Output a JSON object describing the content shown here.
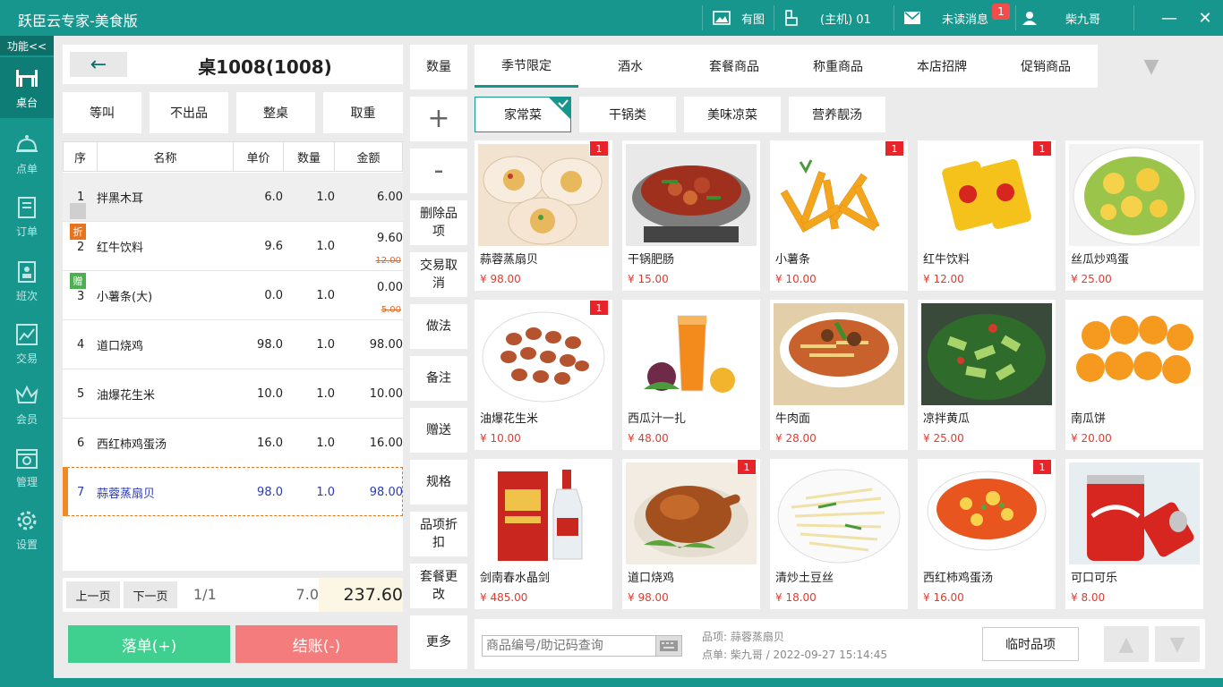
{
  "app": {
    "title": "跃臣云专家-美食版"
  },
  "titlebar": {
    "image_toggle": "有图",
    "host": "(主机) 01",
    "messages": "未读消息",
    "message_count": "1",
    "user": "柴九哥",
    "minimize": "—",
    "close": "✕"
  },
  "sidebar": {
    "func_label": "功能<<",
    "items": [
      {
        "label": "桌台",
        "icon": "table-icon"
      },
      {
        "label": "点单",
        "icon": "bell-icon"
      },
      {
        "label": "订单",
        "icon": "order-icon"
      },
      {
        "label": "班次",
        "icon": "shift-icon"
      },
      {
        "label": "交易",
        "icon": "chart-icon"
      },
      {
        "label": "会员",
        "icon": "crown-icon"
      },
      {
        "label": "管理",
        "icon": "calendar-gear-icon"
      },
      {
        "label": "设置",
        "icon": "gear-icon"
      }
    ]
  },
  "order": {
    "back": "←",
    "table_title": "桌1008(1008)",
    "actions": [
      "等叫",
      "不出品",
      "整桌",
      "取重"
    ],
    "headers": [
      "序",
      "名称",
      "单价",
      "数量",
      "金额"
    ],
    "rows": [
      {
        "no": "1",
        "name": "拌黑木耳",
        "price": "6.0",
        "qty": "1.0",
        "amount": "6.00",
        "tag": "",
        "orig": ""
      },
      {
        "no": "2",
        "name": "红牛饮料",
        "price": "9.6",
        "qty": "1.0",
        "amount": "9.60",
        "tag": "折",
        "orig": "12.00"
      },
      {
        "no": "3",
        "name": "小薯条(大)",
        "price": "0.0",
        "qty": "1.0",
        "amount": "0.00",
        "tag": "赠",
        "orig": "5.00"
      },
      {
        "no": "4",
        "name": "道口烧鸡",
        "price": "98.0",
        "qty": "1.0",
        "amount": "98.00",
        "tag": "",
        "orig": ""
      },
      {
        "no": "5",
        "name": "油爆花生米",
        "price": "10.0",
        "qty": "1.0",
        "amount": "10.00",
        "tag": "",
        "orig": ""
      },
      {
        "no": "6",
        "name": "西红柿鸡蛋汤",
        "price": "16.0",
        "qty": "1.0",
        "amount": "16.00",
        "tag": "",
        "orig": ""
      },
      {
        "no": "7",
        "name": "蒜蓉蒸扇贝",
        "price": "98.0",
        "qty": "1.0",
        "amount": "98.00",
        "tag": "",
        "orig": ""
      }
    ],
    "prev_page": "上一页",
    "next_page": "下一页",
    "page": "1/1",
    "total_qty": "7.0",
    "total_amount": "237.60",
    "place_order": "落单(+)",
    "checkout": "结账(-)"
  },
  "middle": {
    "qty": "数量",
    "plus": "+",
    "minus": "-",
    "buttons": [
      "删除品项",
      "交易取消",
      "做法",
      "备注",
      "赠送",
      "规格",
      "品项折扣",
      "套餐更改",
      "更多"
    ]
  },
  "categories": {
    "tabs": [
      "季节限定",
      "酒水",
      "套餐商品",
      "称重商品",
      "本店招牌",
      "促销商品"
    ],
    "more": "▼",
    "subtabs": [
      "家常菜",
      "干锅类",
      "美味凉菜",
      "营养靓汤"
    ]
  },
  "products": [
    {
      "name": "蒜蓉蒸扇贝",
      "price": "¥ 98.00",
      "qty": "1"
    },
    {
      "name": "干锅肥肠",
      "price": "¥ 15.00",
      "qty": ""
    },
    {
      "name": "小薯条",
      "price": "¥ 10.00",
      "qty": "1"
    },
    {
      "name": "红牛饮料",
      "price": "¥ 12.00",
      "qty": "1"
    },
    {
      "name": "丝瓜炒鸡蛋",
      "price": "¥ 25.00",
      "qty": ""
    },
    {
      "name": "油爆花生米",
      "price": "¥ 10.00",
      "qty": "1"
    },
    {
      "name": "西瓜汁一扎",
      "price": "¥ 48.00",
      "qty": ""
    },
    {
      "name": "牛肉面",
      "price": "¥ 28.00",
      "qty": ""
    },
    {
      "name": "凉拌黄瓜",
      "price": "¥ 25.00",
      "qty": ""
    },
    {
      "name": "南瓜饼",
      "price": "¥ 20.00",
      "qty": ""
    },
    {
      "name": "剑南春水晶剑",
      "price": "¥ 485.00",
      "qty": ""
    },
    {
      "name": "道口烧鸡",
      "price": "¥ 98.00",
      "qty": "1"
    },
    {
      "name": "清炒土豆丝",
      "price": "¥ 18.00",
      "qty": ""
    },
    {
      "name": "西红柿鸡蛋汤",
      "price": "¥ 16.00",
      "qty": "1"
    },
    {
      "name": "可口可乐",
      "price": "¥ 8.00",
      "qty": ""
    }
  ],
  "bottom": {
    "search_placeholder": "商品编号/助记码查询",
    "item_info": "品项: 蒜蓉蒸扇贝",
    "order_info": "点单: 柴九哥 / 2022-09-27 15:14:45",
    "temp_item": "临时品项",
    "up": "▲",
    "down": "▼"
  },
  "colors": {
    "primary": "#17968d",
    "place_order": "#3fcf8f",
    "checkout": "#f47c7c",
    "tag_discount": "#e8731d",
    "tag_gift": "#4caf50",
    "selected_row": "#2b3bb5"
  }
}
